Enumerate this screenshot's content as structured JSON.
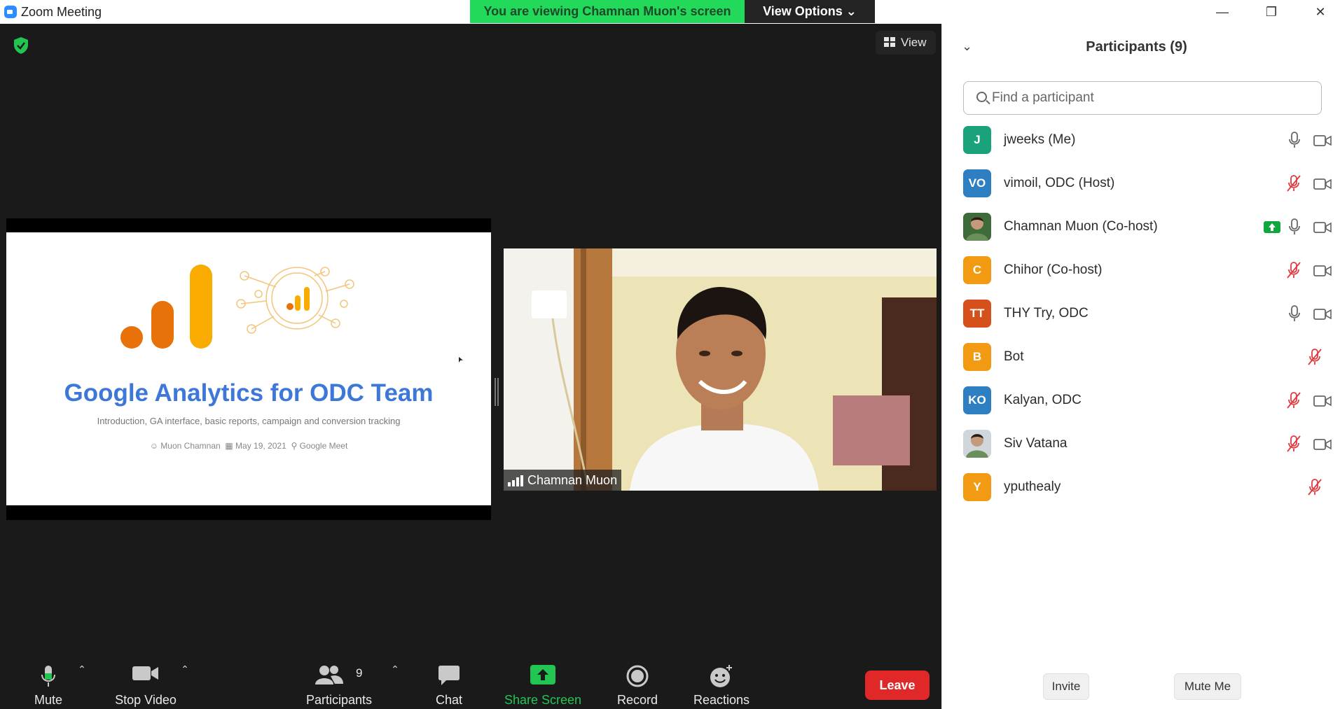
{
  "window": {
    "title": "Zoom Meeting",
    "minimize": "—",
    "maximize": "❐",
    "close": "✕"
  },
  "banner": {
    "viewing_text": "You are viewing Chamnan Muon's screen",
    "view_options": "View Options ⌄"
  },
  "stage": {
    "view_label": "View"
  },
  "slide": {
    "title": "Google Analytics for ODC Team",
    "subtitle": "Introduction, GA interface, basic reports, campaign and conversion tracking",
    "author": "Muon Chamnan",
    "date": "May 19, 2021",
    "location": "Google Meet"
  },
  "video": {
    "name": "Chamnan Muon"
  },
  "toolbar": {
    "mute": "Mute",
    "stop_video": "Stop Video",
    "participants": "Participants",
    "participants_count": "9",
    "chat": "Chat",
    "share_screen": "Share Screen",
    "record": "Record",
    "reactions": "Reactions",
    "leave": "Leave"
  },
  "panel": {
    "title": "Participants (9)",
    "search_placeholder": "Find a participant",
    "invite": "Invite",
    "mute_me": "Mute Me",
    "participants": [
      {
        "initials": "J",
        "name": "jweeks (Me)",
        "color": "#1aa37a",
        "mic": "on",
        "camera": true
      },
      {
        "initials": "VO",
        "name": "vimoil, ODC (Host)",
        "color": "#2d7fc1",
        "mic": "muted",
        "camera": true
      },
      {
        "initials": "",
        "name": "Chamnan Muon (Co-host)",
        "color": "#3e6b3a",
        "mic": "on",
        "camera": true,
        "sharing": true
      },
      {
        "initials": "C",
        "name": "Chihor (Co-host)",
        "color": "#f29a11",
        "mic": "muted",
        "camera": true
      },
      {
        "initials": "TT",
        "name": "THY Try, ODC",
        "color": "#d6501c",
        "mic": "on",
        "camera": true
      },
      {
        "initials": "B",
        "name": "Bot",
        "color": "#f29a11",
        "mic": "muted",
        "camera": false
      },
      {
        "initials": "KO",
        "name": "Kalyan, ODC",
        "color": "#2d7fc1",
        "mic": "muted",
        "camera": true
      },
      {
        "initials": "",
        "name": "Siv Vatana",
        "color": "#cfd6dc",
        "mic": "muted",
        "camera": true
      },
      {
        "initials": "Y",
        "name": "yputhealy",
        "color": "#f29a11",
        "mic": "muted",
        "camera": false
      }
    ]
  }
}
